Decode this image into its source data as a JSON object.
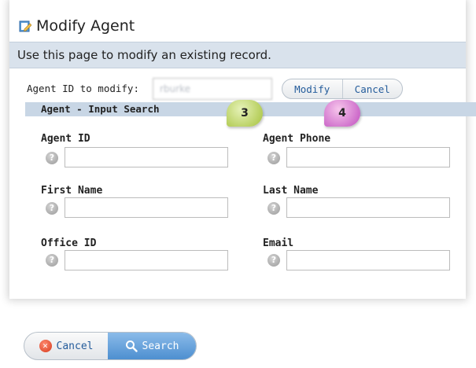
{
  "page": {
    "title": "Modify Agent",
    "subtitle": "Use this page to modify an existing record."
  },
  "modify_row": {
    "label": "Agent ID to modify:",
    "input_value": "rburke",
    "modify_label": "Modify",
    "cancel_label": "Cancel"
  },
  "section": {
    "title": "Agent - Input Search"
  },
  "fields": {
    "agent_id": {
      "label": "Agent ID"
    },
    "agent_phone": {
      "label": "Agent Phone"
    },
    "first_name": {
      "label": "First Name"
    },
    "last_name": {
      "label": "Last Name"
    },
    "office_id": {
      "label": "Office ID"
    },
    "email": {
      "label": "Email"
    }
  },
  "help_glyph": "?",
  "badges": {
    "badge_3": "3",
    "badge_4": "4"
  },
  "actions": {
    "cancel_label": "Cancel",
    "search_label": "Search"
  },
  "icons": {
    "title_icon": "edit-form-icon",
    "help_icon": "help-icon",
    "cancel_icon": "close-icon",
    "search_icon": "search-icon"
  },
  "colors": {
    "accent_blue": "#245c9b",
    "section_bar": "#c8d6e5",
    "subtitle_bar": "#d9e2ec",
    "badge_green": "#a6c23c",
    "badge_pink": "#c04fbf",
    "search_button": "#4d8fd0"
  }
}
